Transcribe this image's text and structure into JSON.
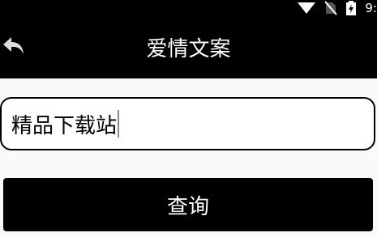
{
  "status_bar": {
    "time": "9:",
    "icons": [
      "wifi-icon",
      "no-sim-icon",
      "battery-charging-icon"
    ]
  },
  "toolbar": {
    "title": "爱情文案",
    "back_icon": "back-arrow-icon"
  },
  "search": {
    "value": "精品下载站",
    "placeholder": ""
  },
  "actions": {
    "query_label": "查询"
  },
  "colors": {
    "toolbar_bg": "#000000",
    "page_bg": "#fafafa",
    "button_bg": "#000000",
    "text_on_dark": "#ffffff"
  }
}
